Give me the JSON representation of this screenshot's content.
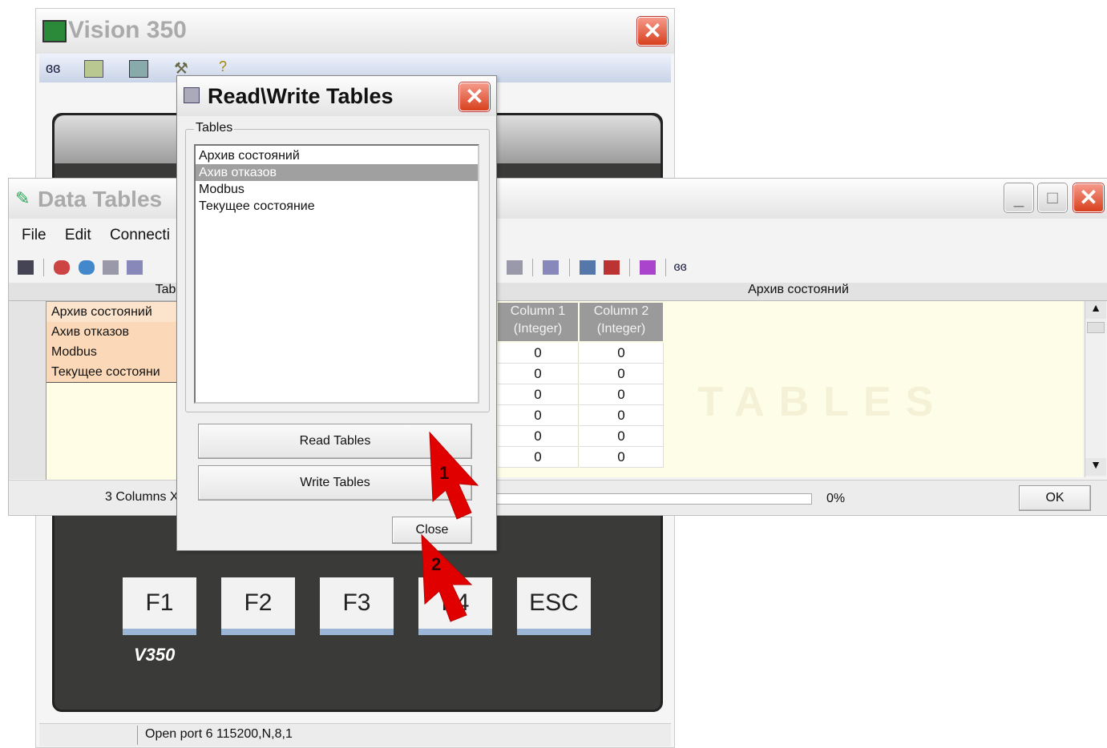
{
  "vision": {
    "title": "Vision 350",
    "fkeys": [
      "F1",
      "F2",
      "F3",
      "F4",
      "ESC"
    ],
    "model": "V350",
    "status_text": "Open port 6 115200,N,8,1"
  },
  "data_tables": {
    "title": "Data Tables",
    "menu": [
      "File",
      "Edit",
      "Connecti"
    ],
    "left_header": "Tabl",
    "table_list": [
      "Архив состояний",
      "Ахив отказов",
      "Modbus",
      "Текущее состояни"
    ],
    "right_header": "Архив состояний",
    "columns": [
      "Column 1\n(Integer)",
      "Column 2\n(Integer)"
    ],
    "rows": [
      [
        "0",
        "0"
      ],
      [
        "0",
        "0"
      ],
      [
        "0",
        "0"
      ],
      [
        "0",
        "0"
      ],
      [
        "0",
        "0"
      ],
      [
        "0",
        "0"
      ]
    ],
    "watermark": "DATA TABLES",
    "status_left": "3 Columns X",
    "progress": "0%",
    "progress_value": 0,
    "ok_label": "OK"
  },
  "rw_dialog": {
    "title": "Read\\Write Tables",
    "group_label": "Tables",
    "tables": [
      "Архив состояний",
      "Ахив отказов",
      "Modbus",
      "Текущее состояние"
    ],
    "selected_index": 1,
    "read_label": "Read Tables",
    "write_label": "Write Tables",
    "close_label": "Close"
  },
  "annotations": {
    "arrow1": "1",
    "arrow2": "2",
    "arrow_color": "#e00000"
  }
}
